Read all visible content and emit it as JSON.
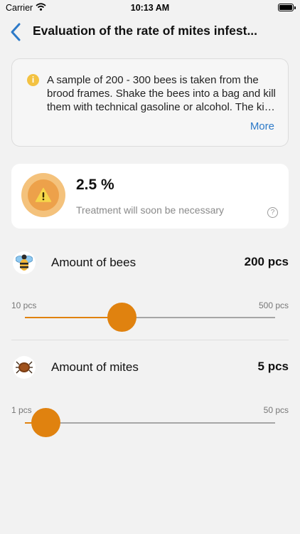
{
  "status_bar": {
    "carrier": "Carrier",
    "time": "10:13 AM",
    "wifi_icon": "wifi-icon",
    "battery_icon": "battery-icon"
  },
  "nav": {
    "title": "Evaluation of the rate of mites infest...",
    "back_icon": "chevron-left-icon"
  },
  "info": {
    "icon": "info-icon",
    "text": "A sample of 200 - 300 bees is taken from the brood frames. Shake the bees into a bag and kill them with technical gasoline or alcohol. The kit is then shaken and the fallen mites are counted.",
    "more_label": "More"
  },
  "result": {
    "icon": "warning-icon",
    "value": "2.5 %",
    "status": "Treatment will soon be necessary",
    "help_label": "?"
  },
  "bees": {
    "label": "Amount of bees",
    "value": "200 pcs",
    "icon": "bee-icon",
    "slider": {
      "min_label": "10 pcs",
      "max_label": "500 pcs",
      "min": 10,
      "max": 500,
      "current": 200
    }
  },
  "mites": {
    "label": "Amount of mites",
    "value": "5 pcs",
    "icon": "mite-icon",
    "slider": {
      "min_label": "1 pcs",
      "max_label": "50 pcs",
      "min": 1,
      "max": 50,
      "current": 5
    }
  },
  "colors": {
    "accent": "#e0820f",
    "link": "#2d7ac8",
    "warning_outer": "#f4c27c",
    "warning_inner": "#eda14a",
    "info_icon": "#f3c242"
  }
}
